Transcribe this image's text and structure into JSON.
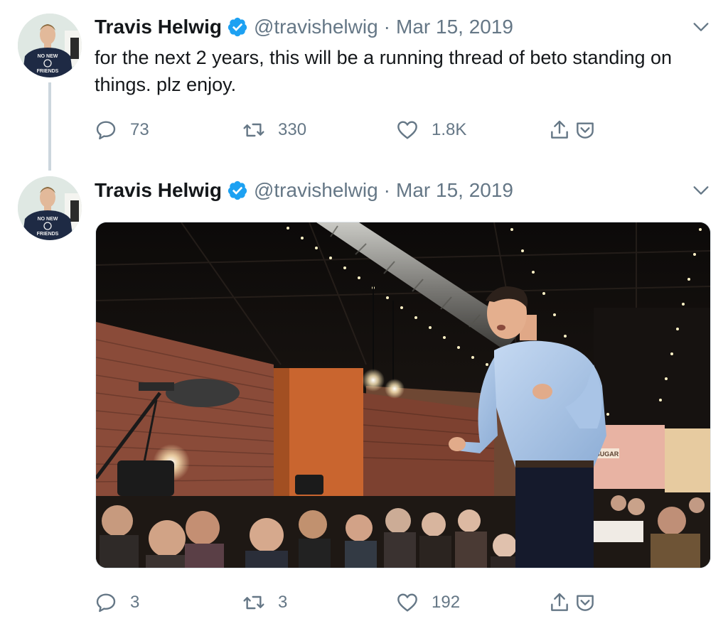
{
  "tweets": [
    {
      "author": {
        "name": "Travis Helwig",
        "handle": "@travishelwig",
        "avatar_shirt_text": "NO NEW FRIENDS"
      },
      "dot": "·",
      "date": "Mar 15, 2019",
      "text": "for the next 2 years, this will be a running thread of beto standing on things. plz enjoy.",
      "stats": {
        "replies": "73",
        "retweets": "330",
        "likes": "1.8K"
      }
    },
    {
      "author": {
        "name": "Travis Helwig",
        "handle": "@travishelwig",
        "avatar_shirt_text": "NO NEW FRIENDS"
      },
      "dot": "·",
      "date": "Mar 15, 2019",
      "media": {
        "sign_text": "SUGAR"
      },
      "stats": {
        "replies": "3",
        "retweets": "3",
        "likes": "192"
      }
    }
  ],
  "icons": {
    "verified": "verified-badge-icon",
    "caret": "chevron-down-icon",
    "reply": "reply-icon",
    "retweet": "retweet-icon",
    "like": "heart-icon",
    "share": "share-icon",
    "save": "save-icon"
  },
  "colors": {
    "verified": "#1da1f2",
    "muted": "#657786",
    "text": "#14171a",
    "thread_line": "#ccd6dd"
  }
}
